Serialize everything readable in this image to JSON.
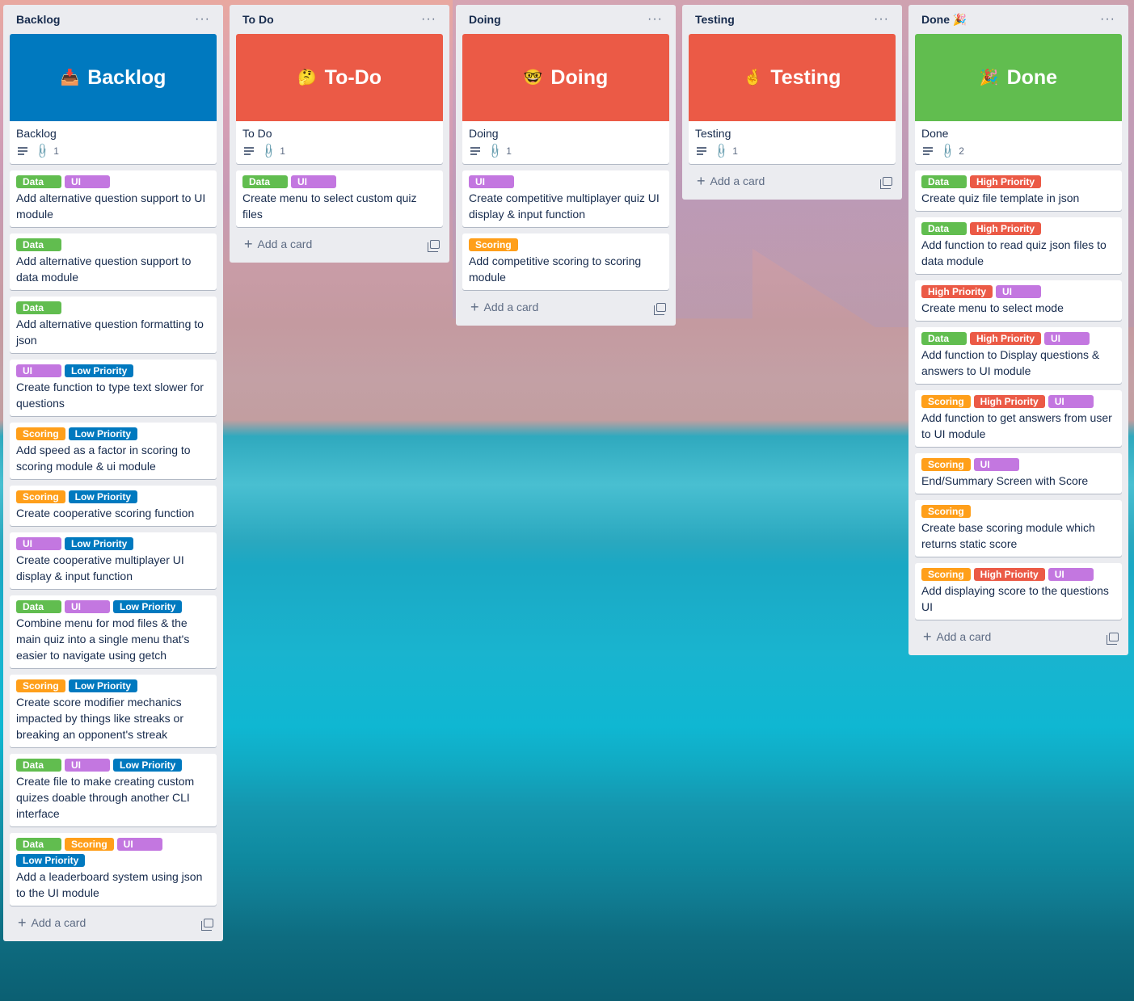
{
  "lists": [
    {
      "title": "Backlog",
      "cover": {
        "emoji": "📥",
        "text": "Backlog",
        "color": "#0079bf",
        "title": "Backlog",
        "attachments": "1"
      },
      "cards": [
        {
          "labels": [
            [
              "data",
              "Data"
            ],
            [
              "ui",
              "UI"
            ]
          ],
          "text": "Add alternative question support to UI module"
        },
        {
          "labels": [
            [
              "data",
              "Data"
            ]
          ],
          "text": "Add alternative question support to data module"
        },
        {
          "labels": [
            [
              "data",
              "Data"
            ]
          ],
          "text": "Add alternative question formatting to json"
        },
        {
          "labels": [
            [
              "ui",
              "UI"
            ],
            [
              "low",
              "Low Priority"
            ]
          ],
          "text": "Create function to type text slower for questions"
        },
        {
          "labels": [
            [
              "scoring",
              "Scoring"
            ],
            [
              "low",
              "Low Priority"
            ]
          ],
          "text": "Add speed as a factor in scoring to scoring module & ui module"
        },
        {
          "labels": [
            [
              "scoring",
              "Scoring"
            ],
            [
              "low",
              "Low Priority"
            ]
          ],
          "text": "Create cooperative scoring function"
        },
        {
          "labels": [
            [
              "ui",
              "UI"
            ],
            [
              "low",
              "Low Priority"
            ]
          ],
          "text": "Create cooperative multiplayer UI display & input function"
        },
        {
          "labels": [
            [
              "data",
              "Data"
            ],
            [
              "ui",
              "UI"
            ],
            [
              "low",
              "Low Priority"
            ]
          ],
          "text": "Combine menu for mod files & the main quiz into a single menu that's easier to navigate using getch"
        },
        {
          "labels": [
            [
              "scoring",
              "Scoring"
            ],
            [
              "low",
              "Low Priority"
            ]
          ],
          "text": "Create score modifier mechanics impacted by things like streaks or breaking an opponent's streak"
        },
        {
          "labels": [
            [
              "data",
              "Data"
            ],
            [
              "ui",
              "UI"
            ],
            [
              "low",
              "Low Priority"
            ]
          ],
          "text": "Create file to make creating custom quizes doable through another CLI interface"
        },
        {
          "labels": [
            [
              "data",
              "Data"
            ],
            [
              "scoring",
              "Scoring"
            ],
            [
              "ui",
              "UI"
            ],
            [
              "low",
              "Low Priority"
            ]
          ],
          "text": "Add a leaderboard system using json to the UI module"
        }
      ],
      "add_label": "Add a card"
    },
    {
      "title": "To Do",
      "cover": {
        "emoji": "🤔",
        "text": "To-Do",
        "color": "#eb5a46",
        "title": "To Do",
        "attachments": "1"
      },
      "cards": [
        {
          "labels": [
            [
              "data",
              "Data"
            ],
            [
              "ui",
              "UI"
            ]
          ],
          "text": "Create menu to select custom quiz files"
        }
      ],
      "add_label": "Add a card"
    },
    {
      "title": "Doing",
      "cover": {
        "emoji": "🤓",
        "text": "Doing",
        "color": "#eb5a46",
        "title": "Doing",
        "attachments": "1"
      },
      "cards": [
        {
          "labels": [
            [
              "ui",
              "UI"
            ]
          ],
          "text": "Create competitive multiplayer quiz UI display & input function"
        },
        {
          "labels": [
            [
              "scoring",
              "Scoring"
            ]
          ],
          "text": "Add competitive scoring to scoring module"
        }
      ],
      "add_label": "Add a card"
    },
    {
      "title": "Testing",
      "cover": {
        "emoji": "🤞",
        "text": "Testing",
        "color": "#eb5a46",
        "title": "Testing",
        "attachments": "1"
      },
      "cards": [],
      "add_label": "Add a card"
    },
    {
      "title": "Done 🎉",
      "cover": {
        "emoji": "🎉",
        "text": "Done",
        "color": "#61bd4f",
        "title": "Done",
        "attachments": "2"
      },
      "cards": [
        {
          "labels": [
            [
              "data",
              "Data"
            ],
            [
              "high",
              "High Priority"
            ]
          ],
          "text": "Create quiz file template in json"
        },
        {
          "labels": [
            [
              "data",
              "Data"
            ],
            [
              "high",
              "High Priority"
            ]
          ],
          "text": "Add function to read quiz json files to data module"
        },
        {
          "labels": [
            [
              "high",
              "High Priority"
            ],
            [
              "ui",
              "UI"
            ]
          ],
          "text": "Create menu to select mode"
        },
        {
          "labels": [
            [
              "data",
              "Data"
            ],
            [
              "high",
              "High Priority"
            ],
            [
              "ui",
              "UI"
            ]
          ],
          "text": "Add function to Display questions & answers to UI module"
        },
        {
          "labels": [
            [
              "scoring",
              "Scoring"
            ],
            [
              "high",
              "High Priority"
            ],
            [
              "ui",
              "UI"
            ]
          ],
          "text": "Add function to get answers from user to UI module"
        },
        {
          "labels": [
            [
              "scoring",
              "Scoring"
            ],
            [
              "ui",
              "UI"
            ]
          ],
          "text": "End/Summary Screen with Score"
        },
        {
          "labels": [
            [
              "scoring",
              "Scoring"
            ]
          ],
          "text": "Create base scoring module which returns static score"
        },
        {
          "labels": [
            [
              "scoring",
              "Scoring"
            ],
            [
              "high",
              "High Priority"
            ],
            [
              "ui",
              "UI"
            ]
          ],
          "text": "Add displaying score to the questions UI"
        }
      ],
      "add_label": "Add a card"
    }
  ],
  "menu_glyph": "···",
  "add_glyph": "+"
}
